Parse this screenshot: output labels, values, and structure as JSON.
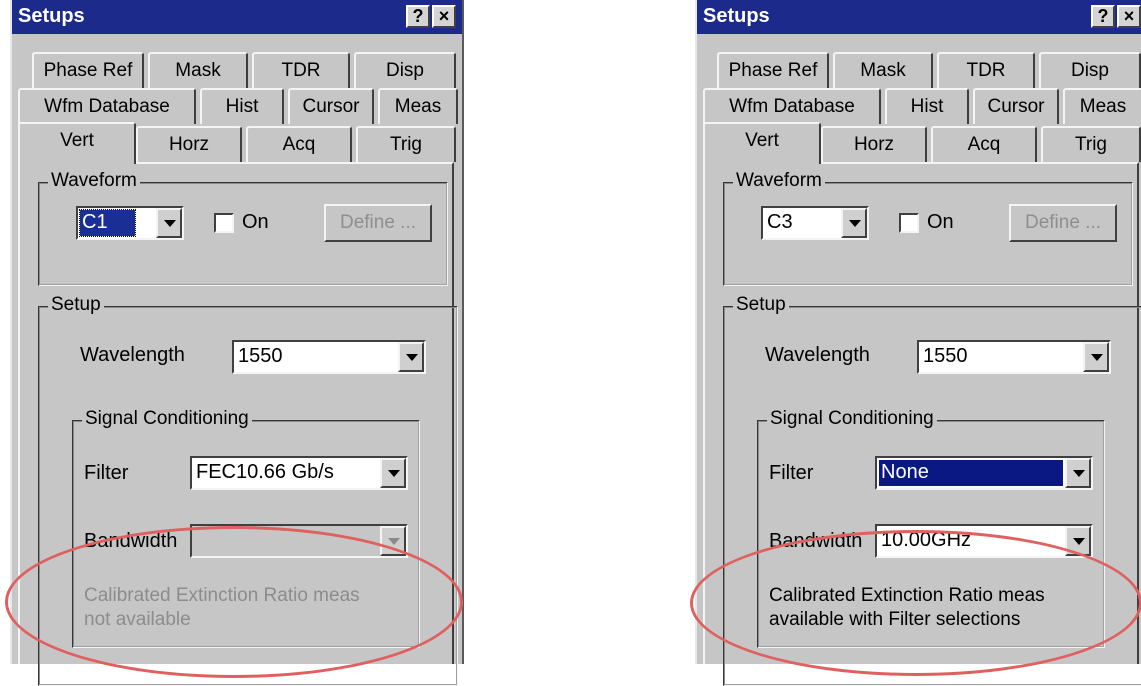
{
  "colors": {
    "titlebar": "#1c2a8c",
    "panel": "#c6c6c6",
    "highlight_ellipse": "#e06060"
  },
  "panels": [
    {
      "title": "Setups",
      "help_button": "?",
      "close_button": "×",
      "tabs_row1": [
        "Phase Ref",
        "Mask",
        "TDR",
        "Disp"
      ],
      "tabs_row2": [
        "Wfm Database",
        "Hist",
        "Cursor",
        "Meas"
      ],
      "tabs_row3": [
        "Vert",
        "Horz",
        "Acq",
        "Trig"
      ],
      "active_tab": "Vert",
      "waveform": {
        "group_label": "Waveform",
        "value": "C1",
        "on_label": "On",
        "define_label": "Define ..."
      },
      "setup": {
        "group_label": "Setup",
        "wavelength_label": "Wavelength",
        "wavelength_value": "1550"
      },
      "signal": {
        "group_label": "Signal Conditioning",
        "filter_label": "Filter",
        "filter_value": "FEC10.66 Gb/s",
        "bandwidth_label": "Bandwidth",
        "bandwidth_value": "",
        "message_line1": "Calibrated Extinction Ratio meas",
        "message_line2": "not available",
        "message_color": "#8c8c8c"
      }
    },
    {
      "title": "Setups",
      "help_button": "?",
      "close_button": "×",
      "tabs_row1": [
        "Phase Ref",
        "Mask",
        "TDR",
        "Disp"
      ],
      "tabs_row2": [
        "Wfm Database",
        "Hist",
        "Cursor",
        "Meas"
      ],
      "tabs_row3": [
        "Vert",
        "Horz",
        "Acq",
        "Trig"
      ],
      "active_tab": "Vert",
      "waveform": {
        "group_label": "Waveform",
        "value": "C3",
        "on_label": "On",
        "define_label": "Define ..."
      },
      "setup": {
        "group_label": "Setup",
        "wavelength_label": "Wavelength",
        "wavelength_value": "1550"
      },
      "signal": {
        "group_label": "Signal Conditioning",
        "filter_label": "Filter",
        "filter_value": "None",
        "bandwidth_label": "Bandwidth",
        "bandwidth_value": "10.00GHz",
        "message_line1": "Calibrated Extinction Ratio meas",
        "message_line2": "available with Filter selections",
        "message_color": "#000000"
      }
    }
  ]
}
